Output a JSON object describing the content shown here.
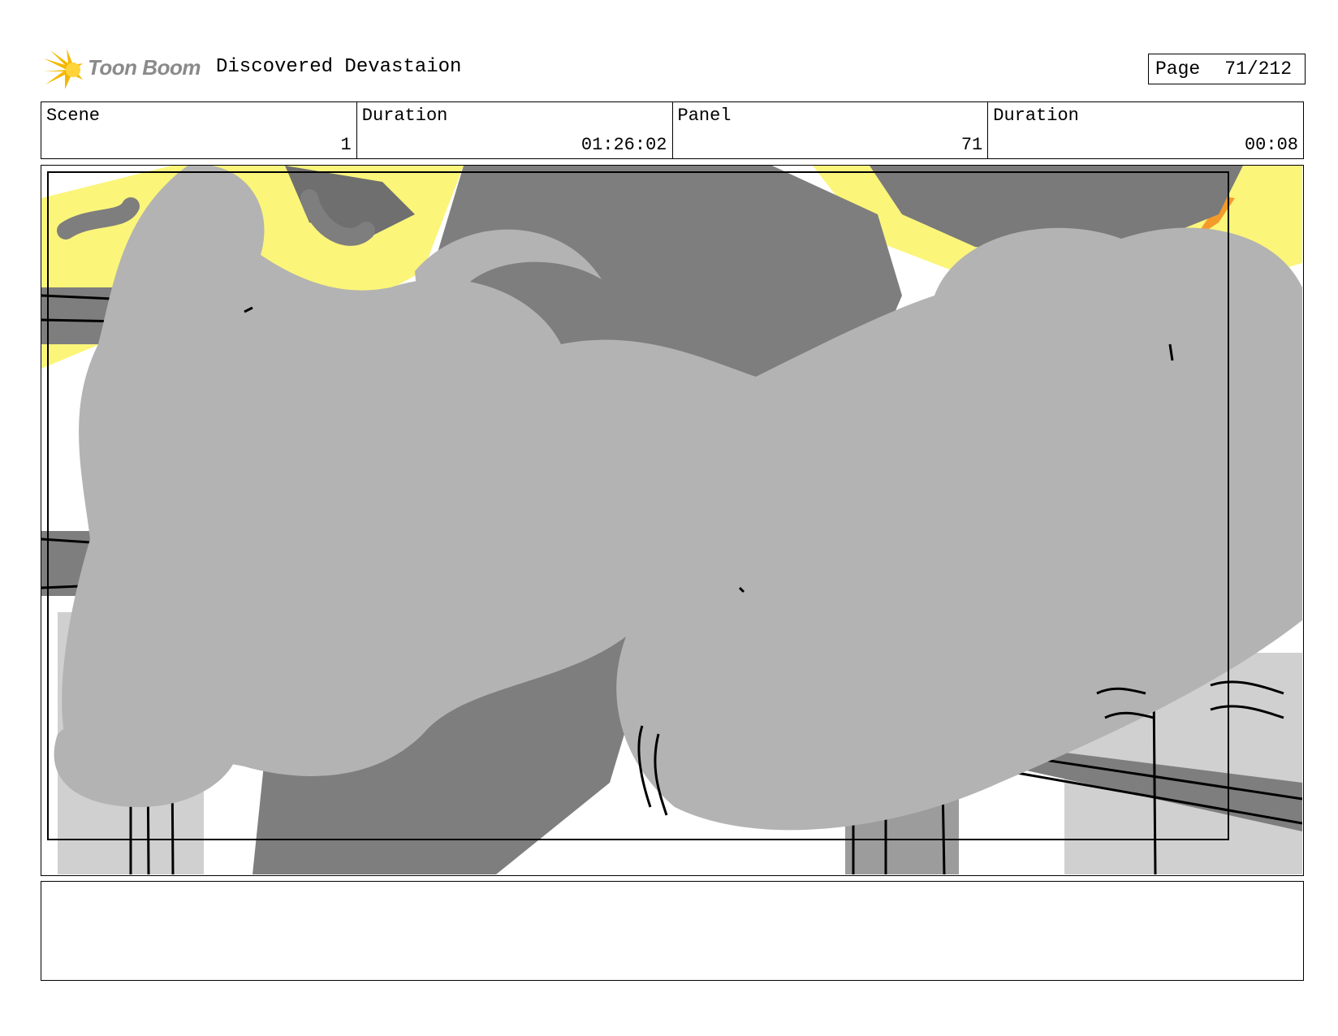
{
  "header": {
    "logo_text": "Toon Boom",
    "project_title": "Discovered Devastaion",
    "page_label": "Page",
    "page_number": "71/212"
  },
  "info": {
    "scene_label": "Scene",
    "scene_value": "1",
    "scene_duration_label": "Duration",
    "scene_duration_value": "01:26:02",
    "panel_label": "Panel",
    "panel_value": "71",
    "panel_duration_label": "Duration",
    "panel_duration_value": "00:08"
  },
  "colors": {
    "logo_accent": "#f5b800",
    "sky_yellow": "#fbf57a",
    "dark_gray": "#7e7e7e",
    "light_gray": "#b3b3b3",
    "orange_accent": "#f39a2b"
  },
  "notes": {
    "text": ""
  }
}
